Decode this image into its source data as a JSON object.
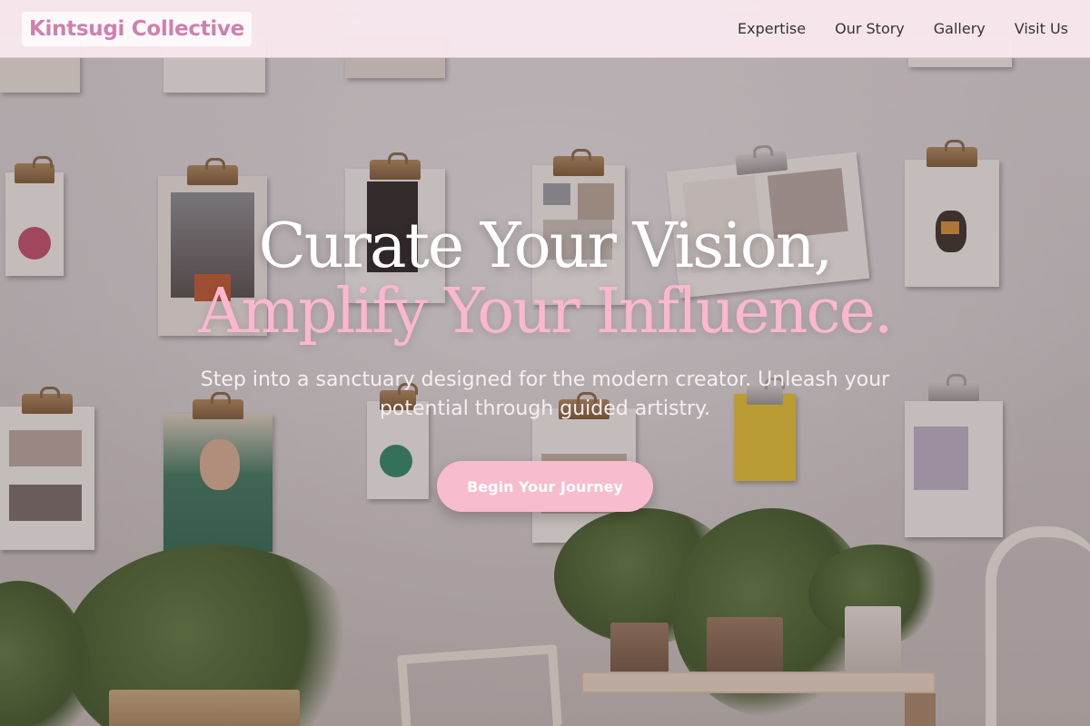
{
  "brand": {
    "name": "Kintsugi Collective",
    "color": "#d07fae"
  },
  "nav": {
    "items": [
      {
        "label": "Expertise"
      },
      {
        "label": "Our Story"
      },
      {
        "label": "Gallery"
      },
      {
        "label": "Visit Us"
      }
    ]
  },
  "hero": {
    "headline_line1": "Curate Your Vision,",
    "headline_line2": "Amplify Your Influence.",
    "subtitle": "Step into a sanctuary designed for the modern creator. Unleash your potential through guided artistry.",
    "cta_label": "Begin Your Journey",
    "accent_color": "#f8bccf"
  },
  "background": {
    "description_icon": "clipboard-wall-with-plants-photo"
  }
}
